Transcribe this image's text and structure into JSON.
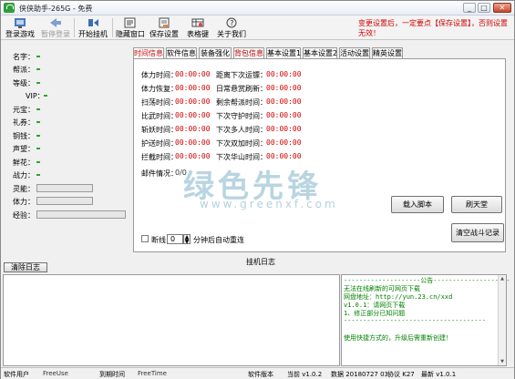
{
  "window": {
    "title": "侠侠助手-265G - 免费"
  },
  "toolbar": {
    "items": [
      {
        "label": "登录游戏",
        "icon": "login-icon"
      },
      {
        "label": "暂停登录",
        "icon": "pause-login-icon"
      },
      {
        "label": "开始挂机",
        "icon": "start-icon"
      },
      {
        "label": "隐藏窗口",
        "icon": "hide-window-icon"
      },
      {
        "label": "保存设置",
        "icon": "save-icon"
      },
      {
        "label": "表格键",
        "icon": "table-icon"
      },
      {
        "label": "关于我们",
        "icon": "about-icon"
      }
    ],
    "notice": "变更设置后，一定要点【保存设置】，否则设置无效！"
  },
  "info": {
    "labels": [
      "名字：",
      "帮派：",
      "等级：",
      "VIP：",
      "元宝：",
      "礼券：",
      "铜钱：",
      "声望：",
      "鲜花：",
      "战力：",
      "灵能：",
      "体力：",
      "经验："
    ]
  },
  "tabs": [
    "时间信息",
    "软件信息",
    "装备强化",
    "背包信息",
    "基本设置1",
    "基本设置2",
    "活动设置",
    "精英设置"
  ],
  "timers": {
    "left": [
      {
        "label": "体力时间：",
        "value": "00:00:00"
      },
      {
        "label": "体力恢复：",
        "value": "00:00:00"
      },
      {
        "label": "扫荡时间：",
        "value": "00:00:00"
      },
      {
        "label": "比武时间：",
        "value": "00:00:00"
      },
      {
        "label": "斩妖时间：",
        "value": "00:00:00"
      },
      {
        "label": "护送时间：",
        "value": "00:00:00"
      },
      {
        "label": "拦截时间：",
        "value": "00:00:00"
      }
    ],
    "right": [
      {
        "label": "距离下次运镖：",
        "value": "00:00:00"
      },
      {
        "label": "日常悬赏刷新：",
        "value": "00:00:00"
      },
      {
        "label": "剩余帮派时间：",
        "value": "00:00:00"
      },
      {
        "label": "下次守护时间：",
        "value": "00:00:00"
      },
      {
        "label": "下次多人时间：",
        "value": "00:00:00"
      },
      {
        "label": "下次双加时间：",
        "value": "00:00:00"
      },
      {
        "label": "下次华山时间：",
        "value": "00:00:00"
      }
    ],
    "mail_label": "邮件情况：",
    "mail_value": "0/0"
  },
  "buttons": {
    "load_script": "载入脚本",
    "refresh": "刷天堂",
    "clear_battle": "清空战斗记录"
  },
  "auto_relogin": {
    "checkbox_label": "断线",
    "minutes": "0",
    "suffix": "分钟后自动重连"
  },
  "watermark": {
    "cn": "绿色先锋",
    "url": "www.greenxf.com"
  },
  "log": {
    "title": "挂机日志",
    "clear_label": "清除日志",
    "announce": [
      "--------------------公告--------------------",
      "无法在线刷新的可网页下载",
      "网盘地址：http://yun.23.cn/xxd",
      "v1.0.1：请网页下载",
      "1、修正部分已知问题",
      "-------------------------------------",
      "",
      "使用快捷方式的，升级后需重新创建！"
    ]
  },
  "status": {
    "user_label": "软件用户",
    "user_value": "FreeUse",
    "expire_label": "到期时间",
    "expire_value": "FreeTime",
    "version_label": "软件版本",
    "current": "当前 v1.0.2",
    "data": "数据 20180727 03",
    "protocol": "协议 K27",
    "latest": "最新 v1.0.1"
  }
}
